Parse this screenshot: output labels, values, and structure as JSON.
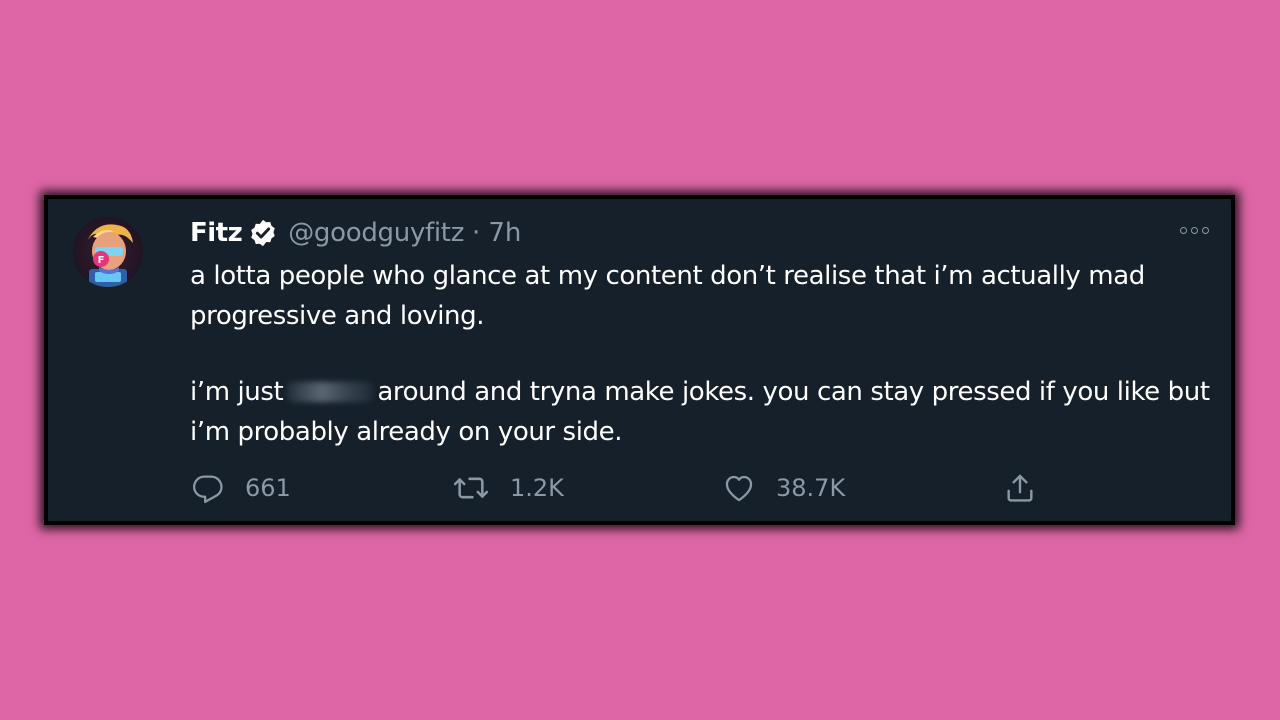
{
  "colors": {
    "background": "#de66a6",
    "card": "#15202b",
    "text_primary": "#ffffff",
    "text_secondary": "#8b98a5",
    "verified": "#ffffff"
  },
  "tweet": {
    "author": {
      "display_name": "Fitz",
      "handle": "@goodguyfitz",
      "verified": true
    },
    "separator": "·",
    "timestamp": "7h",
    "body": {
      "paragraph_1": "a lotta people who glance at my content don’t realise that i’m actually mad progressive and loving.",
      "paragraph_2_before": "i’m just",
      "paragraph_2_after": "around and tryna make jokes. you can stay pressed if you like but i’m probably already on your side."
    },
    "actions": {
      "replies": "661",
      "retweets": "1.2K",
      "likes": "38.7K"
    },
    "icons": {
      "reply": "reply-icon",
      "retweet": "retweet-icon",
      "like": "heart-icon",
      "share": "share-icon",
      "more": "more-icon",
      "verified": "verified-badge-icon"
    }
  }
}
